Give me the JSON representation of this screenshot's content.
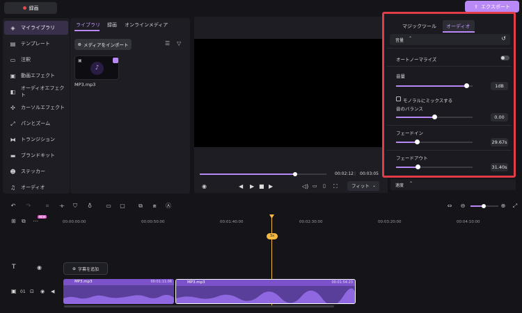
{
  "topbar": {
    "record_label": "録画",
    "export_label": "エクスポート"
  },
  "sidebar": {
    "items": [
      {
        "label": "マイライブラリ",
        "icon": "layers-icon",
        "active": true
      },
      {
        "label": "テンプレート",
        "icon": "template-icon"
      },
      {
        "label": "注釈",
        "icon": "annotation-icon"
      },
      {
        "label": "動画エフェクト",
        "icon": "video-effect-icon"
      },
      {
        "label": "オーディオエフェクト",
        "icon": "audio-effect-icon"
      },
      {
        "label": "カーソルエフェクト",
        "icon": "cursor-effect-icon"
      },
      {
        "label": "パンとズーム",
        "icon": "pan-zoom-icon"
      },
      {
        "label": "トランジション",
        "icon": "transition-icon"
      },
      {
        "label": "ブランドキット",
        "icon": "brand-kit-icon"
      },
      {
        "label": "ステッカー",
        "icon": "sticker-icon"
      },
      {
        "label": "オーディオ",
        "icon": "music-icon"
      }
    ]
  },
  "library": {
    "tabs": [
      "ライブラリ",
      "録画",
      "オンラインメディア"
    ],
    "import_label": "メディアをインポート",
    "file_name": "MP3.mp3"
  },
  "preview": {
    "current_time": "00:02:12",
    "total_time": "00:03:05",
    "fit_label": "フィット",
    "progress": 0.75
  },
  "properties": {
    "tabs": [
      "マジックツール",
      "オーディオ"
    ],
    "section_volume": "音量",
    "auto_normalize": "オートノーマライズ",
    "volume_label": "音量",
    "volume_value": "1dB",
    "volume_level": 0.92,
    "mono_label": "モノラルにミックスする",
    "balance_label": "音のバランス",
    "balance_value": "0.00",
    "balance_level": 0.5,
    "fadein_label": "フェードイン",
    "fadein_value": "29.67s",
    "fadein_level": 0.27,
    "fadeout_label": "フェードアウト",
    "fadeout_value": "31.40s",
    "fadeout_level": 0.28,
    "section_speed": "速度"
  },
  "timeline": {
    "ticks": [
      "00:00:00:00",
      "00:00:50:00",
      "00:01:40:00",
      "00:02:30:00",
      "00:03:20:00",
      "00:04:10:00"
    ],
    "playhead_label": "3x",
    "new_badge": "NEW",
    "add_caption": "字幕を追加",
    "track_number": "01",
    "clips": [
      {
        "name": "MP3.mp3",
        "time": "00:01:11:06"
      },
      {
        "name": "MP3.mp3",
        "time": "00:01:54:23"
      }
    ]
  },
  "colors": {
    "accent": "#b98af7",
    "highlight": "#e23c48",
    "playhead": "#f5b942"
  }
}
